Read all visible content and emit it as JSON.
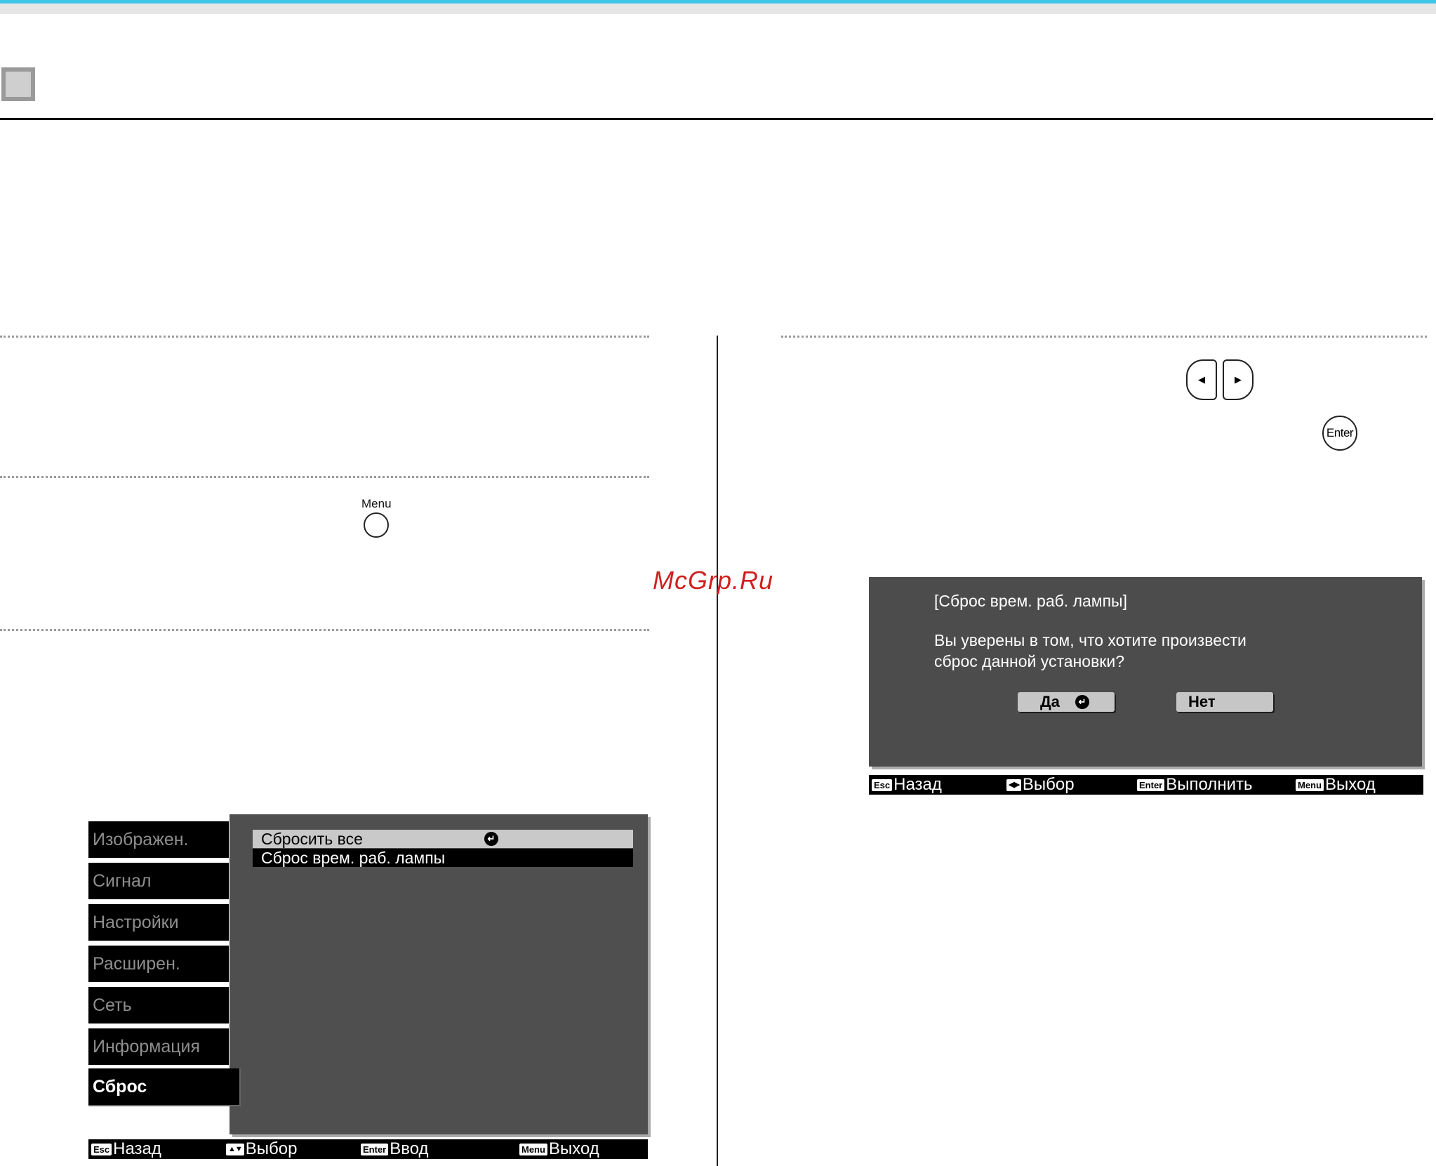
{
  "watermark": "McGrp.Ru",
  "remote": {
    "menu_label": "Menu",
    "enter_label": "Enter",
    "left_arrow": "◀",
    "right_arrow": "▶"
  },
  "menu_screen": {
    "sidebar": [
      "Изображен.",
      "Сигнал",
      "Настройки",
      "Расширен.",
      "Сеть",
      "Информация",
      "Сброс"
    ],
    "options": [
      {
        "label": "Сбросить все",
        "selected": true
      },
      {
        "label": "Сброс врем. раб. лампы",
        "selected": false
      }
    ],
    "enter_glyph": "↵",
    "footer": [
      {
        "key": "Esc",
        "label": "Назад"
      },
      {
        "key": "▲▼",
        "label": "Выбор"
      },
      {
        "key": "Enter",
        "label": "Ввод"
      },
      {
        "key": "Menu",
        "label": "Выход"
      }
    ]
  },
  "dialog": {
    "title": "[Сброс врем. раб. лампы]",
    "message_line1": "Вы уверены в том, что хотите произвести",
    "message_line2": "сброс данной установки?",
    "yes": "Да",
    "no": "Нет",
    "footer": [
      {
        "key": "Esc",
        "label": "Назад"
      },
      {
        "key": "◀▶",
        "label": "Выбор"
      },
      {
        "key": "Enter",
        "label": "Выполнить"
      },
      {
        "key": "Menu",
        "label": "Выход"
      }
    ]
  },
  "colors": {
    "accent_rule": "#3ec6e8",
    "menu_panel": "#4f4f4f",
    "watermark": "#d02020"
  }
}
